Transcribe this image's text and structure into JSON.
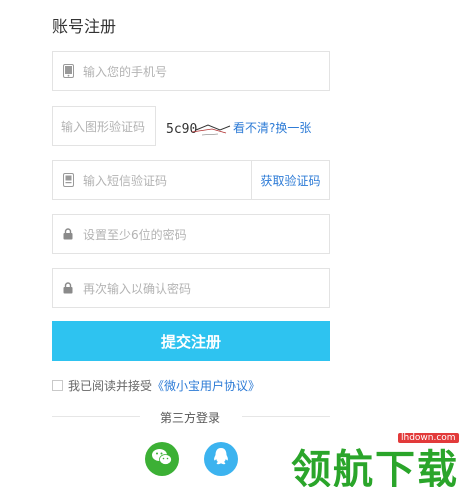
{
  "form": {
    "title": "账号注册",
    "phone_placeholder": "输入您的手机号",
    "captcha_placeholder": "输入图形验证码",
    "captcha_code": "5c90",
    "captcha_refresh": "看不清?换一张",
    "sms_placeholder": "输入短信验证码",
    "sms_button": "获取验证码",
    "password_placeholder": "设置至少6位的密码",
    "password_confirm_placeholder": "再次输入以确认密码",
    "submit_label": "提交注册",
    "agree_text": "我已阅读并接受",
    "agree_link": "《微小宝用户协议》"
  },
  "third_party": {
    "label": "第三方登录",
    "providers": [
      {
        "name": "wechat",
        "icon": "wechat-icon",
        "color": "#3cb035"
      },
      {
        "name": "qq",
        "icon": "qq-icon",
        "color": "#3cb3ef"
      }
    ]
  },
  "watermark": {
    "site": "lhdown.com",
    "text": "领航下载"
  },
  "colors": {
    "accent": "#2ec3f0",
    "link": "#2d7bd6"
  }
}
